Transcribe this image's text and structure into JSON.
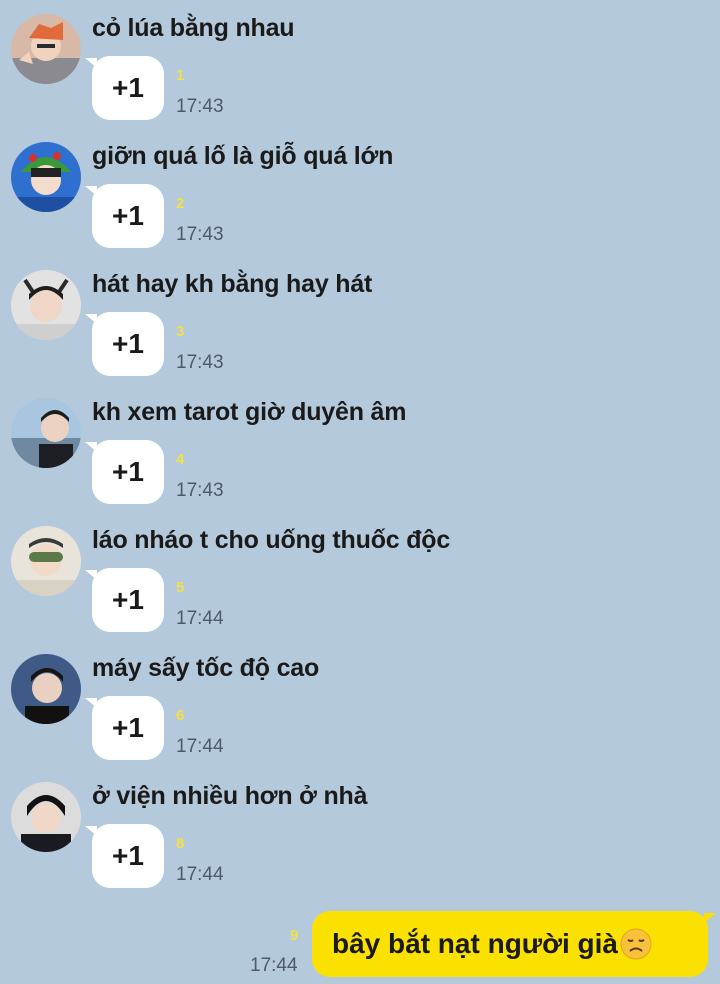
{
  "colors": {
    "background": "#b5c9dc",
    "incoming_bubble": "#ffffff",
    "outgoing_bubble": "#fae100",
    "unread_counter": "#f2e04a",
    "timestamp": "#4f5a66"
  },
  "messages": [
    {
      "sender": "cỏ lúa bằng nhau",
      "text": "+1",
      "unread": "1",
      "time": "17:43",
      "avatar_icon": "avatar-photo-icon"
    },
    {
      "sender": "giỡn quá lố là giỗ quá lớn",
      "text": "+1",
      "unread": "2",
      "time": "17:43",
      "avatar_icon": "avatar-photo-icon"
    },
    {
      "sender": "hát hay kh bằng hay hát",
      "text": "+1",
      "unread": "3",
      "time": "17:43",
      "avatar_icon": "avatar-photo-icon"
    },
    {
      "sender": "kh xem tarot giờ duyên âm",
      "text": "+1",
      "unread": "4",
      "time": "17:43",
      "avatar_icon": "avatar-photo-icon"
    },
    {
      "sender": "láo nháo t cho uống thuốc độc",
      "text": "+1",
      "unread": "5",
      "time": "17:44",
      "avatar_icon": "avatar-photo-icon"
    },
    {
      "sender": "máy sấy tốc độ cao",
      "text": "+1",
      "unread": "6",
      "time": "17:44",
      "avatar_icon": "avatar-photo-icon"
    },
    {
      "sender": "ở viện nhiều hơn ở nhà",
      "text": "+1",
      "unread": "8",
      "time": "17:44",
      "avatar_icon": "avatar-photo-icon"
    }
  ],
  "outgoing": {
    "text": "bây bắt nạt người già",
    "emoji_icon": "disappointed-face-icon",
    "unread": "9",
    "time": "17:44"
  }
}
